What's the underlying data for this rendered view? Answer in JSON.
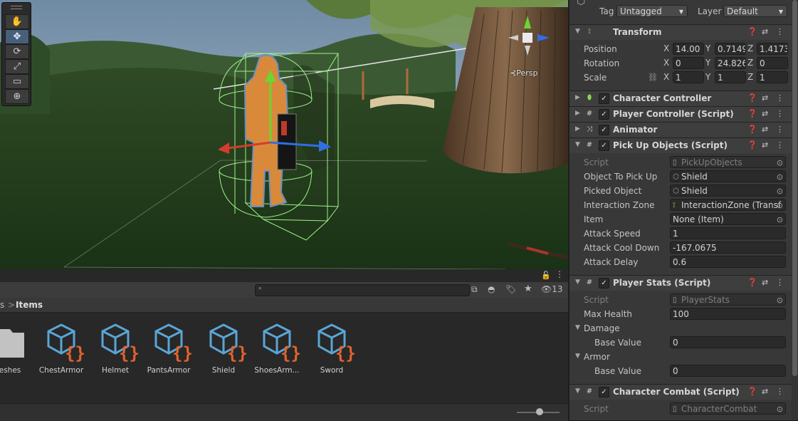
{
  "scene": {
    "view_mode_label": "Persp",
    "tools": [
      {
        "name": "hand-tool",
        "glyph": "✋"
      },
      {
        "name": "move-tool",
        "glyph": "✥"
      },
      {
        "name": "rotate-tool",
        "glyph": "⟳"
      },
      {
        "name": "scale-tool",
        "glyph": "⤢"
      },
      {
        "name": "rect-tool",
        "glyph": "▭"
      },
      {
        "name": "transform-tool",
        "glyph": "⊕"
      }
    ]
  },
  "project": {
    "hidden_count": "13",
    "breadcrumb": {
      "prev": "s",
      "separator": ">",
      "current": "Items"
    },
    "assets": [
      {
        "label": "eshes",
        "type": "folder"
      },
      {
        "label": "ChestArmor",
        "type": "script"
      },
      {
        "label": "Helmet",
        "type": "script"
      },
      {
        "label": "PantsArmor",
        "type": "script"
      },
      {
        "label": "Shield",
        "type": "script"
      },
      {
        "label": "ShoesArm...",
        "type": "script"
      },
      {
        "label": "Sword",
        "type": "script"
      }
    ]
  },
  "inspector": {
    "tag_label": "Tag",
    "tag_value": "Untagged",
    "layer_label": "Layer",
    "layer_value": "Default",
    "transform": {
      "title": "Transform",
      "position_label": "Position",
      "rotation_label": "Rotation",
      "scale_label": "Scale",
      "position": {
        "x": "14.00",
        "y": "0.7149",
        "z": "1.4173"
      },
      "rotation": {
        "x": "0",
        "y": "24.826",
        "z": "0"
      },
      "scale": {
        "x": "1",
        "y": "1",
        "z": "1"
      }
    },
    "character_controller": {
      "title": "Character Controller"
    },
    "player_controller": {
      "title": "Player Controller (Script)"
    },
    "animator": {
      "title": "Animator"
    },
    "pickup": {
      "title": "Pick Up Objects (Script)",
      "script_label": "Script",
      "script_value": "PickUpObjects",
      "object_to_pick_up_label": "Object To Pick Up",
      "object_to_pick_up_value": "Shield",
      "picked_object_label": "Picked Object",
      "picked_object_value": "Shield",
      "interaction_zone_label": "Interaction Zone",
      "interaction_zone_value": "InteractionZone (Transf",
      "item_label": "Item",
      "item_value": "None (Item)",
      "attack_speed_label": "Attack Speed",
      "attack_speed_value": "1",
      "attack_cooldown_label": "Attack Cool Down",
      "attack_cooldown_value": "-167.0675",
      "attack_delay_label": "Attack Delay",
      "attack_delay_value": "0.6"
    },
    "player_stats": {
      "title": "Player Stats (Script)",
      "script_label": "Script",
      "script_value": "PlayerStats",
      "max_health_label": "Max Health",
      "max_health_value": "100",
      "damage_label": "Damage",
      "damage_base_label": "Base Value",
      "damage_base_value": "0",
      "armor_label": "Armor",
      "armor_base_label": "Base Value",
      "armor_base_value": "0"
    },
    "character_combat": {
      "title": "Character Combat (Script)",
      "script_label": "Script",
      "script_value": "CharacterCombat"
    }
  }
}
